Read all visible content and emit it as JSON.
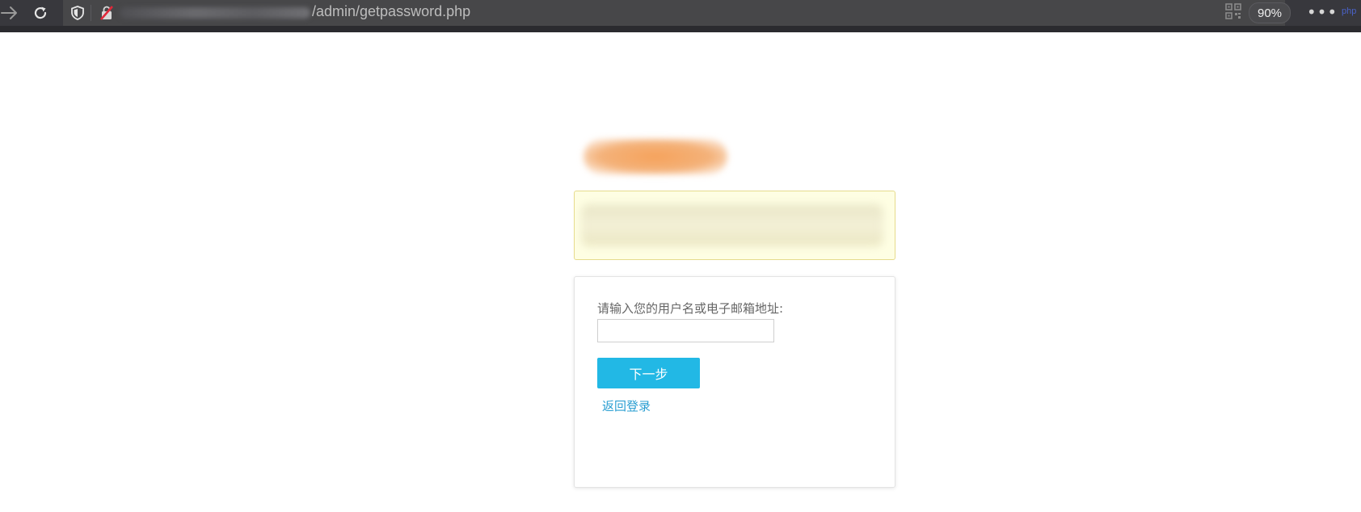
{
  "browser": {
    "url_path": "/admin/getpassword.php",
    "zoom": "90%",
    "more_menu": "•••",
    "extension_label": "php",
    "icons": [
      "back-arrow-icon",
      "reload-icon",
      "shield-icon",
      "insecure-lock-icon",
      "qr-code-icon",
      "more-icon"
    ]
  },
  "form": {
    "label": "请输入您的用户名或电子邮箱地址:",
    "input_value": "",
    "next_button": "下一步",
    "back_link": "返回登录"
  },
  "colors": {
    "primary_button": "#22b8e5",
    "link": "#2b9fd2",
    "notice_bg": "#fefee3",
    "notice_border": "#e6db8c"
  }
}
